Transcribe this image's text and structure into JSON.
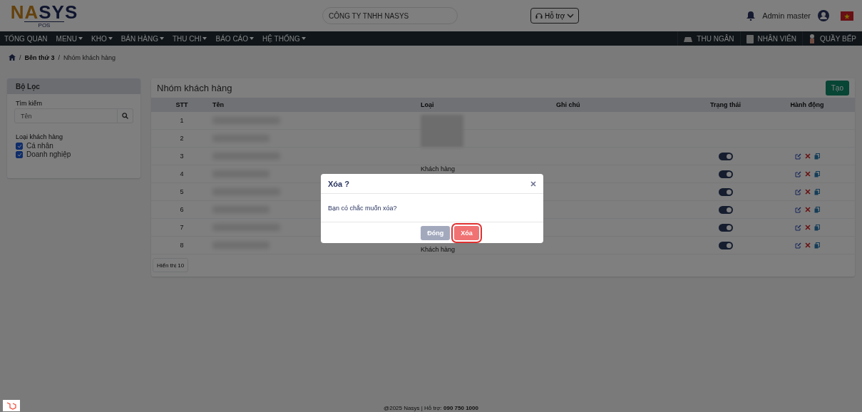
{
  "header": {
    "logo": [
      "NA",
      "SYS"
    ],
    "logo_sub": "POS",
    "company": "CÔNG TY TNHH NASYS",
    "support": "Hỗ trợ",
    "user": "Admin master"
  },
  "nav": {
    "items": [
      {
        "label": "TỔNG QUAN",
        "dropdown": false
      },
      {
        "label": "MENU",
        "dropdown": true
      },
      {
        "label": "KHO",
        "dropdown": true
      },
      {
        "label": "BÁN HÀNG",
        "dropdown": true
      },
      {
        "label": "THU CHI",
        "dropdown": true
      },
      {
        "label": "BÁO CÁO",
        "dropdown": true
      },
      {
        "label": "HỆ THỐNG",
        "dropdown": true
      }
    ],
    "right": [
      {
        "label": "THU NGÂN",
        "kind": "cashier"
      },
      {
        "label": "NHÂN VIÊN",
        "kind": "staff"
      },
      {
        "label": "QUẦY BẾP",
        "kind": "chef"
      }
    ]
  },
  "breadcrumb": [
    {
      "text": "/",
      "kind": "separator"
    },
    {
      "text": "Bên thứ 3",
      "kind": "link"
    },
    {
      "text": "/",
      "kind": "separator"
    },
    {
      "text": "Nhóm khách hàng",
      "kind": "current"
    }
  ],
  "filter": {
    "title": "Bộ Lọc",
    "search_label": "Tìm kiếm",
    "placeholder": "Tên",
    "group_label": "Loại khách hàng",
    "options": [
      {
        "label": "Cá nhân",
        "checked": true
      },
      {
        "label": "Doanh nghiệp",
        "checked": true
      }
    ]
  },
  "table": {
    "title": "Nhóm khách hàng",
    "create": "Tạo",
    "columns": [
      "STT",
      "Tên",
      "Loại",
      "Ghi chú",
      "Trạng thái",
      "Hành động"
    ],
    "rows": [
      {
        "stt": "1",
        "kind": "plain"
      },
      {
        "stt": "2",
        "kind": "plain"
      },
      {
        "stt": "3",
        "kind": "active",
        "on": true
      },
      {
        "stt": "4",
        "kind": "active",
        "on": true,
        "type": "Khách hàng"
      },
      {
        "stt": "5",
        "kind": "active",
        "on": true
      },
      {
        "stt": "6",
        "kind": "active",
        "on": true
      },
      {
        "stt": "7",
        "kind": "active",
        "on": true
      },
      {
        "stt": "8",
        "kind": "active",
        "on": true,
        "type": "Khách hàng"
      }
    ],
    "page_size": "Hiển thị 10"
  },
  "footer": "@2025 Nasys | Hỗ trợ: **090 750 1000**",
  "modal": {
    "title": "Xóa ?",
    "message": "Bạn có chắc muốn xóa?",
    "buttons": [
      {
        "label": "Đóng",
        "kind": "secondary",
        "highlighted": false
      },
      {
        "label": "Xóa",
        "kind": "danger",
        "highlighted": true
      }
    ]
  }
}
